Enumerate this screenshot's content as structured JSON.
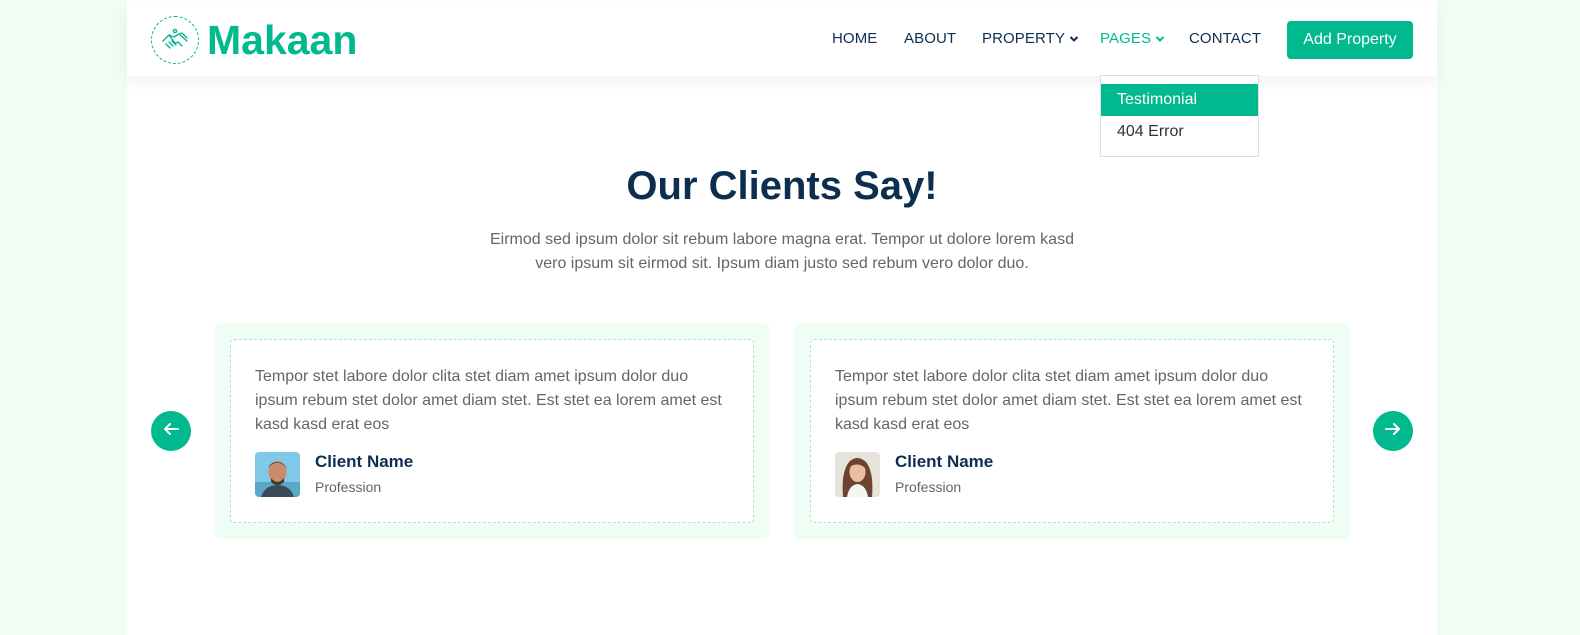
{
  "brand": {
    "name": "Makaan",
    "icon": "handshake-icon"
  },
  "nav": {
    "items": [
      {
        "label": "HOME"
      },
      {
        "label": "ABOUT"
      },
      {
        "label": "PROPERTY"
      },
      {
        "label": "PAGES"
      },
      {
        "label": "CONTACT"
      }
    ],
    "cta_label": "Add Property"
  },
  "dropdown": {
    "items": [
      "Testimonial",
      "404 Error"
    ]
  },
  "section": {
    "title": "Our Clients Say!",
    "subtitle": "Eirmod sed ipsum dolor sit rebum labore magna erat. Tempor ut dolore lorem kasd vero ipsum sit eirmod sit. Ipsum diam justo sed rebum vero dolor duo."
  },
  "testimonials": [
    {
      "text": "Tempor stet labore dolor clita stet diam amet ipsum dolor duo ipsum rebum stet dolor amet diam stet. Est stet ea lorem amet est kasd kasd erat eos",
      "name": "Client Name",
      "profession": "Profession"
    },
    {
      "text": "Tempor stet labore dolor clita stet diam amet ipsum dolor duo ipsum rebum stet dolor amet diam stet. Est stet ea lorem amet est kasd kasd erat eos",
      "name": "Client Name",
      "profession": "Profession"
    }
  ],
  "colors": {
    "primary": "#00b98e",
    "dark": "#0e2e50",
    "light": "#effdf5"
  }
}
